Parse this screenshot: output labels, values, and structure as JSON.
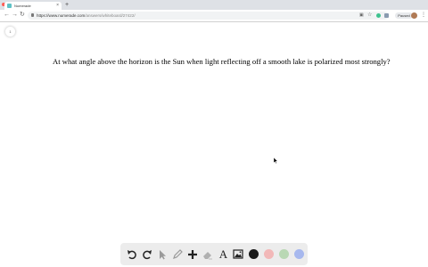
{
  "browser": {
    "tab_title": "Numerade",
    "tab_close": "×",
    "new_tab": "+",
    "url_main": "https://www.numerade.com",
    "url_path": "/answers/whiteboard/27422/",
    "profile_status": "Paused"
  },
  "page": {
    "page_number": "1",
    "question": "At what angle above the horizon is the Sun when light reflecting off a smooth lake is polarized most strongly?"
  },
  "toolbar": {
    "tools": [
      "undo-icon",
      "redo-icon",
      "pointer-icon",
      "pen-icon",
      "add-icon",
      "eraser-icon",
      "text-icon",
      "image-icon"
    ],
    "text_tool_label": "A",
    "colors": [
      "#1a1a1a",
      "#f2b8b8",
      "#b9d8b4",
      "#a7b8ee"
    ]
  }
}
